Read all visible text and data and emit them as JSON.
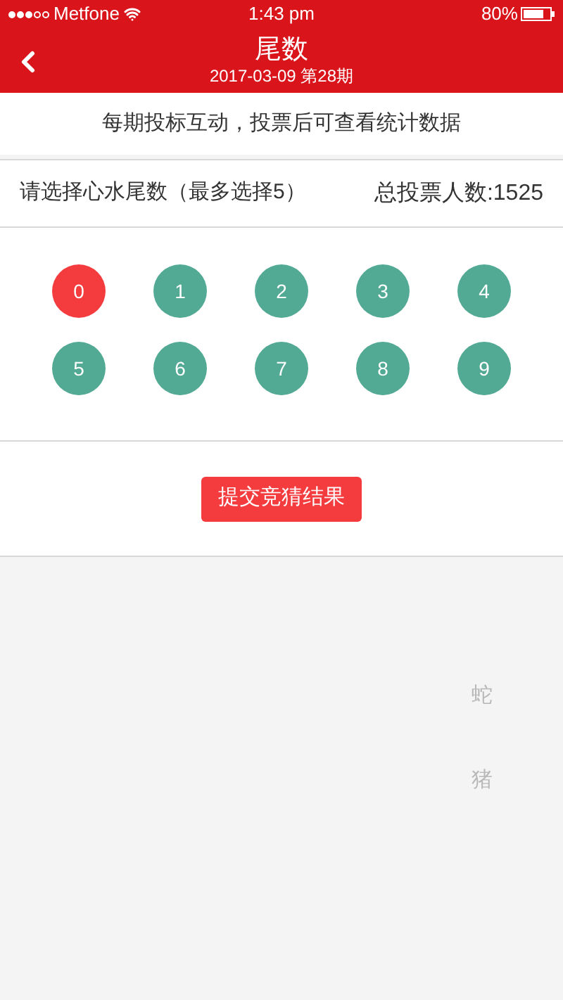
{
  "status_bar": {
    "carrier": "Metfone",
    "time": "1:43 pm",
    "battery": "80%"
  },
  "header": {
    "title": "尾数",
    "subtitle": "2017-03-09 第28期"
  },
  "notice": "每期投标互动，投票后可查看统计数据",
  "selection": {
    "prompt": "请选择心水尾数（最多选择5）",
    "total_votes": "总投票人数:1525"
  },
  "numbers": [
    {
      "label": "0",
      "selected": true
    },
    {
      "label": "1",
      "selected": false
    },
    {
      "label": "2",
      "selected": false
    },
    {
      "label": "3",
      "selected": false
    },
    {
      "label": "4",
      "selected": false
    },
    {
      "label": "5",
      "selected": false
    },
    {
      "label": "6",
      "selected": false
    },
    {
      "label": "7",
      "selected": false
    },
    {
      "label": "8",
      "selected": false
    },
    {
      "label": "9",
      "selected": false
    }
  ],
  "submit_button": "提交竞猜结果",
  "faint_labels": [
    "蛇",
    "猪"
  ]
}
